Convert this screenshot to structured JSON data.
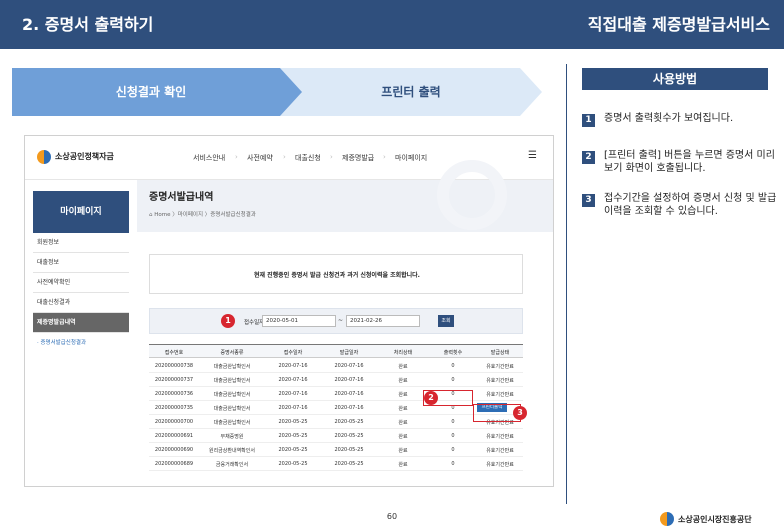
{
  "header": {
    "left_title": "2. 증명서 출력하기",
    "right_title": "직접대출 제증명발급서비스"
  },
  "steps": [
    {
      "label": "신청결과 확인"
    },
    {
      "label": "프린터 출력"
    }
  ],
  "usage": {
    "title": "사용방법",
    "items": [
      {
        "num": "1",
        "text": "증명서 출력횟수가 보여집니다."
      },
      {
        "num": "2",
        "text": "[프린터 출력] 버튼을 누르면 증명서 미리보기 화면이 호출됩니다."
      },
      {
        "num": "3",
        "text": "접수기간을 설정하여 증명서 신청 및 발급이력을 조회할 수 있습니다."
      }
    ]
  },
  "site": {
    "logo_text": "소상공인정책자금",
    "nav": [
      "서비스안내",
      "사전예약",
      "대출신청",
      "제증명발급",
      "마이페이지"
    ],
    "menu_icon": "☰"
  },
  "sidebar": {
    "title": "마이페이지",
    "items": [
      "회원정보",
      "대출정보",
      "사전예약확인",
      "대출신청결과",
      "제증명발급내역"
    ],
    "sub_item": "· 증명서발급신청결과"
  },
  "main": {
    "title": "증명서발급내역",
    "breadcrumb": "⌂ Home 〉마이페이지 〉증명서발급신청결과",
    "notice": "현재 진행중인 증명서 발급 신청건과 과거 신청이력을 조회합니다."
  },
  "search": {
    "label": "접수일자",
    "date_from": "2020-05-01",
    "date_to": "2021-02-26",
    "tilde": "~",
    "button": "조회"
  },
  "table": {
    "columns": [
      "접수번호",
      "증명서종류",
      "접수일자",
      "발급일자",
      "처리상태",
      "출력횟수",
      "발급상태"
    ],
    "rows": [
      [
        "202000000738",
        "대출금완납확인서",
        "2020-07-16",
        "2020-07-16",
        "완료",
        "0",
        "유효기간만료"
      ],
      [
        "202000000737",
        "대출금완납확인서",
        "2020-07-16",
        "2020-07-16",
        "완료",
        "0",
        "유효기간만료"
      ],
      [
        "202000000736",
        "대출금완납확인서",
        "2020-07-16",
        "2020-07-16",
        "완료",
        "0",
        "유효기간만료"
      ],
      [
        "202000000735",
        "대출금완납확인서",
        "2020-07-16",
        "2020-07-16",
        "완료",
        "0",
        "프린터출력"
      ],
      [
        "202000000700",
        "대출금완납확인서",
        "2020-05-25",
        "2020-05-25",
        "완료",
        "0",
        "유효기간만료"
      ],
      [
        "202000000691",
        "부채증명원",
        "2020-05-25",
        "2020-05-25",
        "완료",
        "0",
        "유효기간만료"
      ],
      [
        "202000000690",
        "원리금상환내역확인서",
        "2020-05-25",
        "2020-05-25",
        "완료",
        "0",
        "유효기간만료"
      ],
      [
        "202000000689",
        "금융거래확인서",
        "2020-05-25",
        "2020-05-25",
        "완료",
        "0",
        "유효기간만료"
      ]
    ]
  },
  "callouts": [
    "1",
    "2",
    "3"
  ],
  "footer": {
    "page_number": "60",
    "org_name": "소상공인시장진흥공단"
  },
  "colors": {
    "primary": "#2f4f7d",
    "accent_red": "#d7262f",
    "step_active": "#6f9fd8",
    "step_inactive": "#dce9f7",
    "button_blue": "#2d6db5"
  }
}
